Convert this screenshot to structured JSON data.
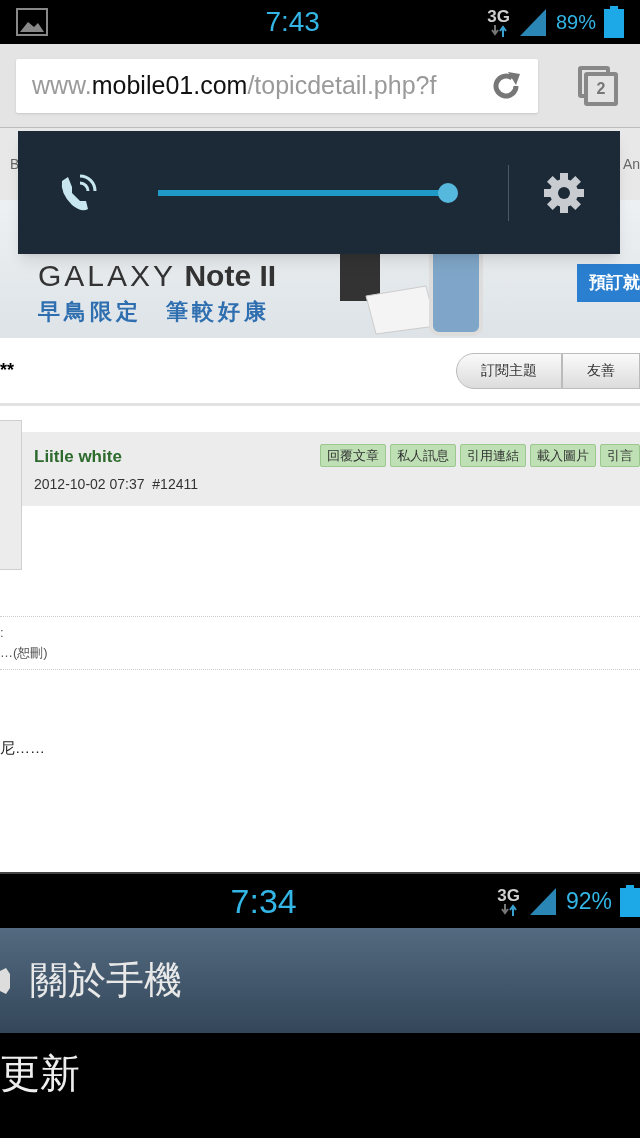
{
  "status_bar": {
    "time": "7:43",
    "network": "3G",
    "battery": "89%"
  },
  "address_bar": {
    "url_prefix": "www.",
    "url_domain": "mobile01.com",
    "url_path": "/topicdetail.php?f",
    "tab_count": "2"
  },
  "volume_panel": {
    "level": 1
  },
  "page": {
    "nav_left": "B",
    "nav_right": "An",
    "banner": {
      "title_light": "GALAXY",
      "title_bold": "Note II",
      "slogan_1": "早鳥限定",
      "slogan_2": "筆較好康",
      "cta": "預訂就"
    },
    "topic_title": "**",
    "topic_buttons": [
      "訂閱主題",
      "友善"
    ],
    "post": {
      "author": "Liitle white",
      "meta": "2012-10-02 07:37  #12411",
      "actions": [
        "回覆文章",
        "私人訊息",
        "引用連結",
        "載入圖片",
        "引言"
      ],
      "quote": [
        ":",
        "…(恕刪)"
      ],
      "body": "尼……"
    }
  },
  "embedded_screenshot": {
    "status_bar": {
      "time": "7:34",
      "network": "3G",
      "battery": "92%"
    },
    "title": "關於手機",
    "item": "更新"
  }
}
